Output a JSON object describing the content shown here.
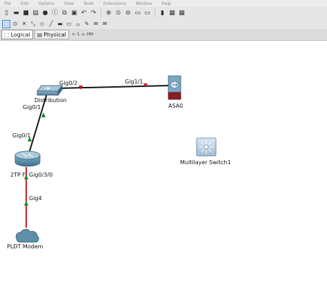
{
  "menu": [
    "File",
    "Edit",
    "Options",
    "View",
    "Tools",
    "Extensions",
    "Window",
    "Help"
  ],
  "toolbar_main": [
    {
      "icon": "new-file-icon",
      "glyph": "▯"
    },
    {
      "icon": "open-folder-icon",
      "glyph": "▬"
    },
    {
      "icon": "save-icon",
      "glyph": "■"
    },
    {
      "icon": "print-icon",
      "glyph": "▤"
    },
    {
      "icon": "activity-wizard-icon",
      "glyph": "●"
    },
    {
      "icon": "network-info-icon",
      "glyph": "ⓘ"
    },
    {
      "icon": "copy-icon",
      "glyph": "⧉"
    },
    {
      "icon": "paste-icon",
      "glyph": "▣"
    },
    {
      "icon": "undo-icon",
      "glyph": "↶"
    },
    {
      "icon": "redo-icon",
      "glyph": "↷"
    },
    {
      "icon": "zoom-in-icon",
      "glyph": "⊕"
    },
    {
      "icon": "zoom-reset-icon",
      "glyph": "⊙"
    },
    {
      "icon": "zoom-out-icon",
      "glyph": "⊖"
    },
    {
      "icon": "drawing-palette-icon",
      "glyph": "▭"
    },
    {
      "icon": "custom-devices-icon",
      "glyph": "▭"
    },
    {
      "icon": "phone-icon",
      "glyph": "▮"
    },
    {
      "icon": "monitor-icon",
      "glyph": "▦"
    },
    {
      "icon": "chart-icon",
      "glyph": "▦"
    }
  ],
  "toolbar_secondary": [
    {
      "icon": "select-icon",
      "glyph": "⬚",
      "selected": true
    },
    {
      "icon": "inspect-icon",
      "glyph": "⊙"
    },
    {
      "icon": "delete-icon",
      "glyph": "✕"
    },
    {
      "icon": "resize-icon",
      "glyph": "⤡"
    },
    {
      "icon": "note-icon",
      "glyph": "◇"
    },
    {
      "icon": "draw-line-icon",
      "glyph": "╱"
    },
    {
      "icon": "draw-rectangle-icon",
      "glyph": "▬"
    },
    {
      "icon": "draw-ellipse-icon",
      "glyph": "▭"
    },
    {
      "icon": "draw-freeform-icon",
      "glyph": "⌓"
    },
    {
      "icon": "pen-icon",
      "glyph": "✎"
    },
    {
      "icon": "add-pdu-icon",
      "glyph": "✉"
    },
    {
      "icon": "add-complex-pdu-icon",
      "glyph": "✉"
    }
  ],
  "tabs": {
    "logical": "Logical",
    "physical": "Physical",
    "coords": "x: 1, y: 280"
  },
  "devices": {
    "distribution": "Distribution",
    "asa": "ASA0",
    "multilayer": "Multilayer Switch1",
    "router": "2TP F",
    "modem": "PLDT Modem"
  },
  "ports": {
    "dist_gig02": "Gig0/2",
    "asa_gig11": "Gig1/1",
    "dist_gig01": "Gig0/1",
    "router_gig01": "Gig0/1",
    "router_gig030": "Gig0/3/0",
    "modem_gig4": "Gig4"
  },
  "colors": {
    "link_up": "#1a8a1a",
    "link_down": "#c8141e",
    "copper_red": "#c81e28",
    "cable_black": "#111111"
  }
}
